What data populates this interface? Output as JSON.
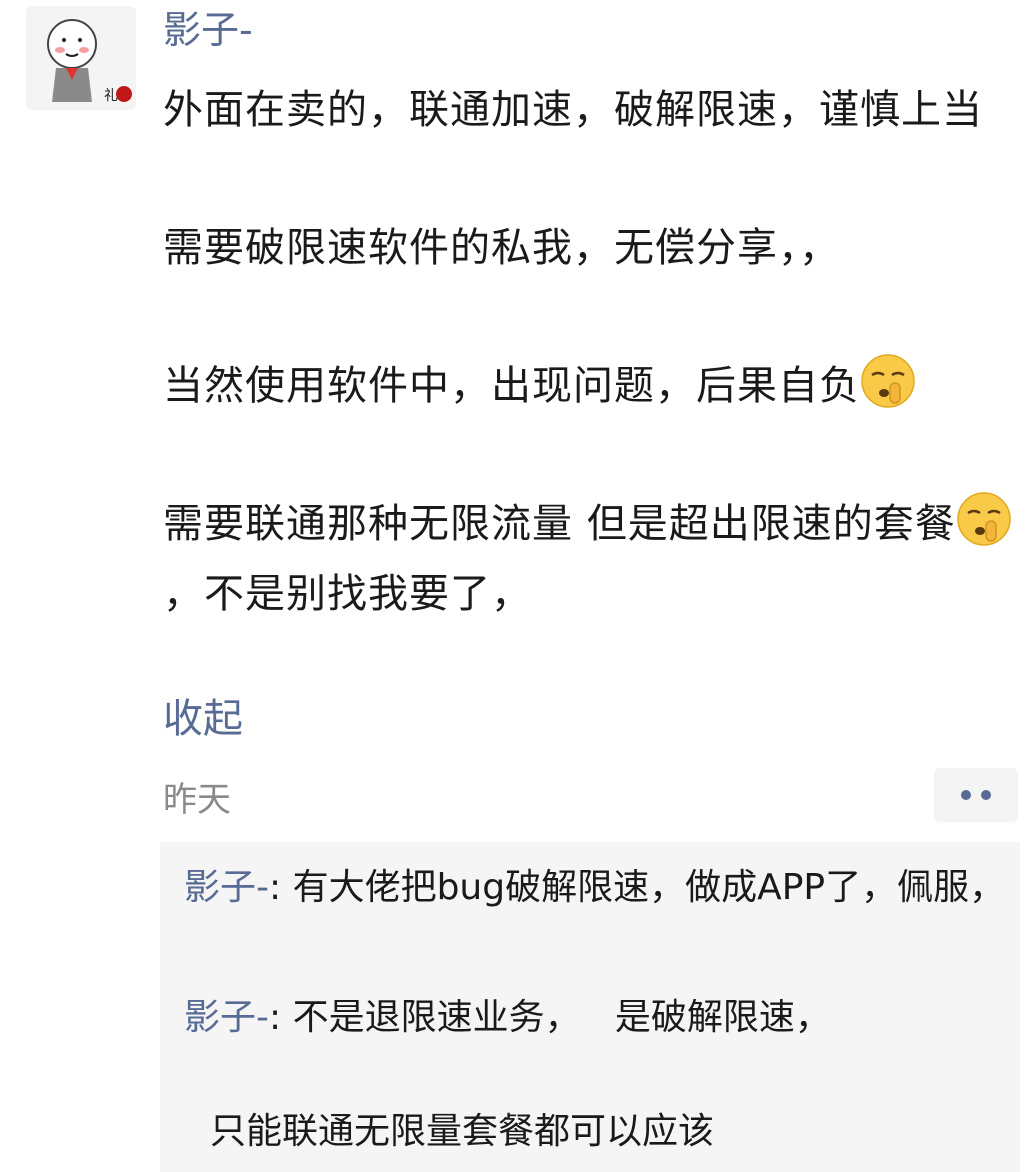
{
  "post": {
    "author": "影子-",
    "paragraphs": [
      "外面在卖的，联通加速，破解限速，谨慎上当",
      "需要破限速软件的私我，无偿分享，，",
      "当然使用软件中，出现问题，后果自负",
      "需要联通那种无限流量 但是超出限速的套餐"
    ],
    "paragraph_5_tail": "，不是别找我要了，",
    "collapse_label": "收起",
    "timestamp": "昨天"
  },
  "emojis": [
    "shushing-face-emoji",
    "shushing-face-emoji"
  ],
  "comments": [
    {
      "author": "影子-",
      "separator": ": ",
      "text": "有大佬把bug破解限速，做成APP了，佩服，"
    },
    {
      "author": "影子-",
      "separator": ": ",
      "text": "不是退限速业务，   是破解限速，"
    }
  ],
  "comment_continuation": "只能联通无限量套餐都可以应该",
  "colors": {
    "link": "#576b95",
    "text": "#1a1a1a",
    "muted": "#8a8a8a",
    "panel": "#f5f5f5"
  }
}
